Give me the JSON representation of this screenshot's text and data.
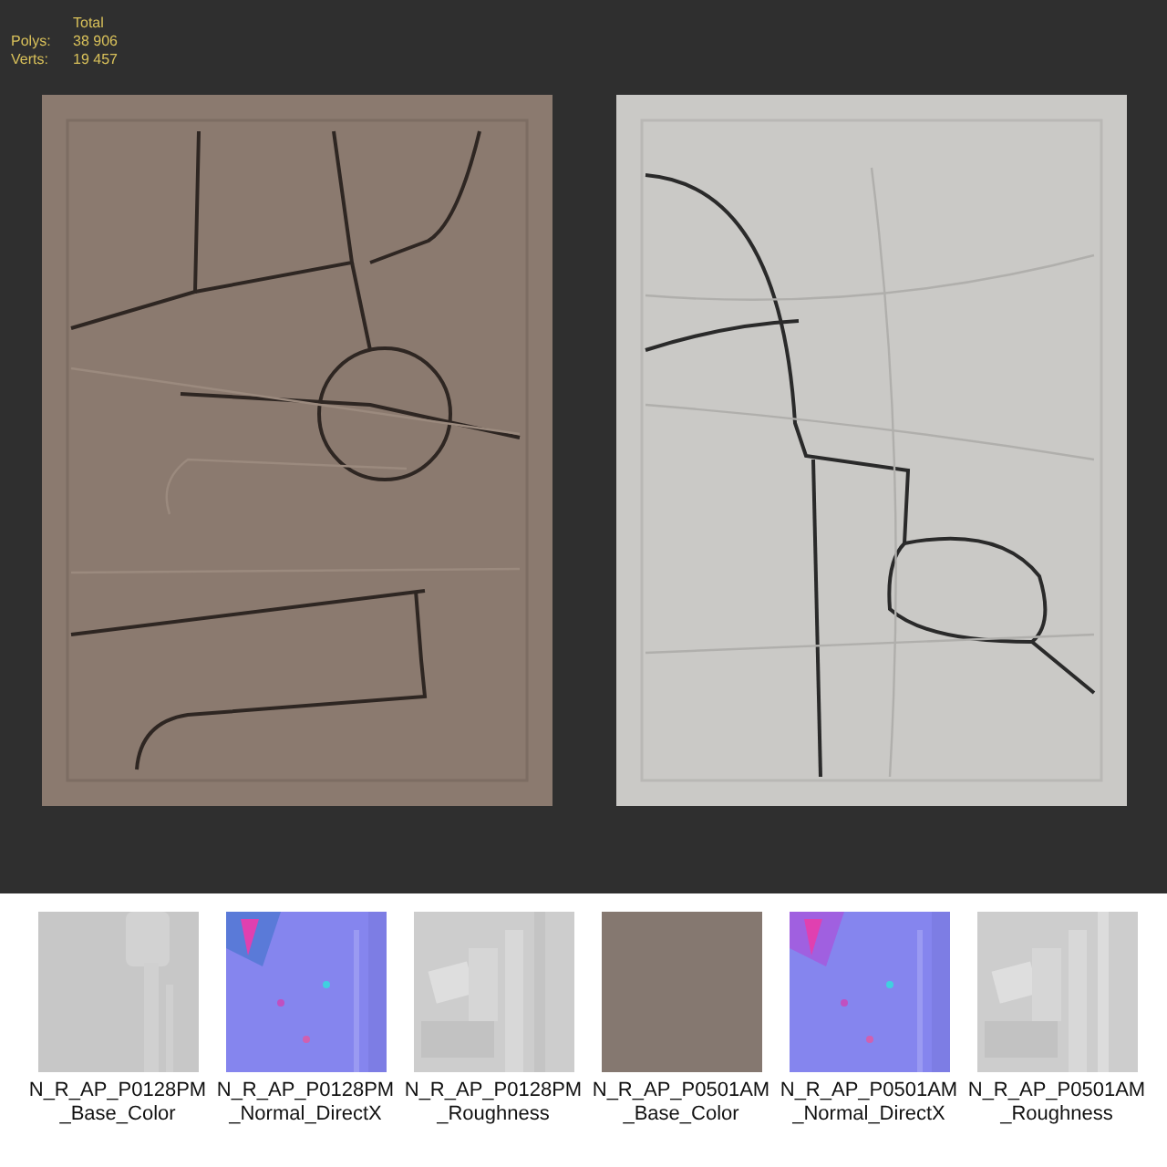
{
  "viewport": {
    "stats": {
      "heading": "Total",
      "rows": [
        {
          "label": "Polys:",
          "value": "38 906"
        },
        {
          "label": "Verts:",
          "value": "19 457"
        }
      ]
    }
  },
  "textures": [
    {
      "name": "N_R_AP_P0128PM_Base_Color",
      "kind": "picture"
    },
    {
      "name": "N_R_AP_P0128PM_Normal_DirectX",
      "kind": "picture"
    },
    {
      "name": "N_R_AP_P0128PM_Roughness",
      "kind": "picture"
    },
    {
      "name": "N_R_AP_P0501AM_Base_Color",
      "kind": "picture"
    },
    {
      "name": "N_R_AP_P0501AM_Normal_DirectX",
      "kind": "picture"
    },
    {
      "name": "N_R_AP_P0501AM_Roughness",
      "kind": "picture"
    }
  ]
}
